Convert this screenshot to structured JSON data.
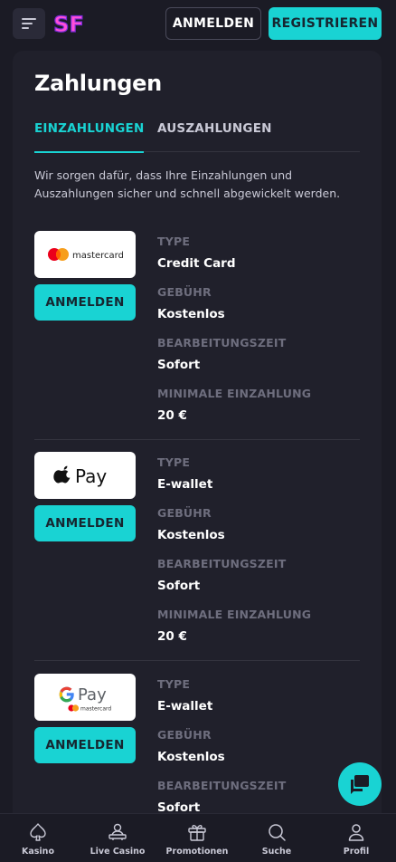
{
  "header": {
    "logo_text": "SF",
    "login_label": "ANMELDEN",
    "register_label": "REGISTRIEREN"
  },
  "page": {
    "title": "Zahlungen",
    "tabs": [
      {
        "label": "EINZAHLUNGEN",
        "active": true
      },
      {
        "label": "AUSZAHLUNGEN",
        "active": false
      }
    ],
    "intro": "Wir sorgen dafür, dass Ihre Einzahlungen und Auszahlungen sicher und schnell abgewickelt werden."
  },
  "methods": [
    {
      "logo": "mastercard",
      "logo_text": "mastercard",
      "button_label": "ANMELDEN",
      "fields": [
        {
          "label": "TYPE",
          "value": "Credit Card"
        },
        {
          "label": "GEBÜHR",
          "value": "Kostenlos"
        },
        {
          "label": "BEARBEITUNGSZEIT",
          "value": "Sofort"
        },
        {
          "label": "MINIMALE EINZAHLUNG",
          "value": "20 €"
        }
      ]
    },
    {
      "logo": "apple-pay",
      "logo_text": "Pay",
      "button_label": "ANMELDEN",
      "fields": [
        {
          "label": "TYPE",
          "value": "E-wallet"
        },
        {
          "label": "GEBÜHR",
          "value": "Kostenlos"
        },
        {
          "label": "BEARBEITUNGSZEIT",
          "value": "Sofort"
        },
        {
          "label": "MINIMALE EINZAHLUNG",
          "value": "20 €"
        }
      ]
    },
    {
      "logo": "google-pay",
      "logo_text": "Pay",
      "logo_subtext": "mastercard",
      "button_label": "ANMELDEN",
      "fields": [
        {
          "label": "TYPE",
          "value": "E-wallet"
        },
        {
          "label": "GEBÜHR",
          "value": "Kostenlos"
        },
        {
          "label": "BEARBEITUNGSZEIT",
          "value": "Sofort"
        }
      ]
    }
  ],
  "bottom_nav": [
    {
      "label": "Kasino",
      "icon": "spade-icon"
    },
    {
      "label": "Live Casino",
      "icon": "dealer-icon"
    },
    {
      "label": "Promotionen",
      "icon": "gift-icon"
    },
    {
      "label": "Suche",
      "icon": "search-icon"
    },
    {
      "label": "Profil",
      "icon": "user-icon"
    }
  ],
  "colors": {
    "accent": "#19d3d3",
    "background": "#1b1b25",
    "card": "#20202b",
    "label": "#6e6e7e",
    "logo_pink": "#ff4fd8"
  }
}
